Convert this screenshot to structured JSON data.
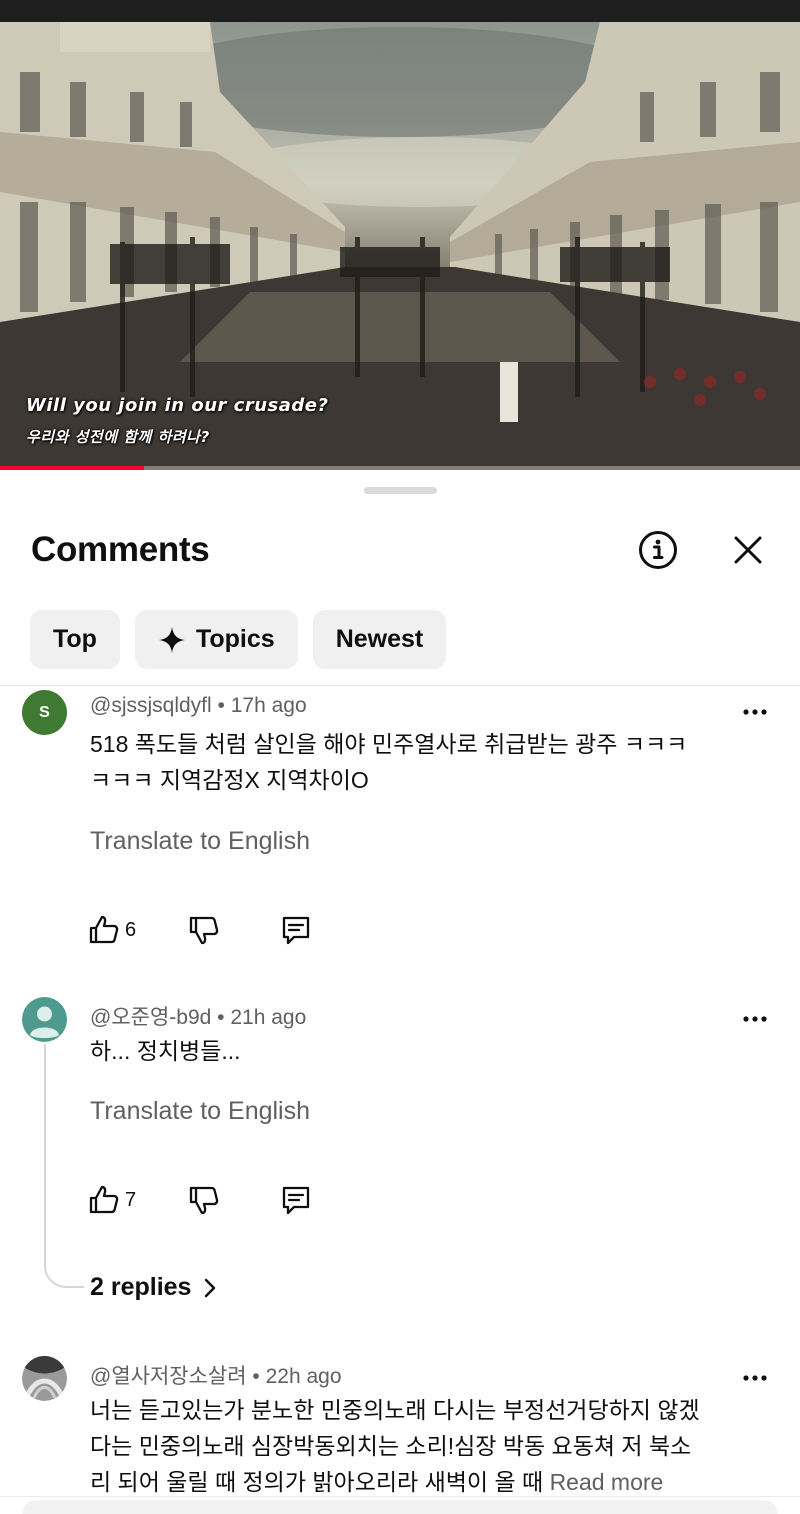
{
  "video": {
    "subtitle_en": "Will you join in our crusade?",
    "subtitle_ko": "우리와 성전에 함께 하려나?",
    "progress": 0.18
  },
  "sheet": {
    "title": "Comments",
    "info_icon": "info-circle-icon",
    "close_icon": "close-icon"
  },
  "filters": [
    {
      "label": "Top"
    },
    {
      "label": "Topics",
      "icon": "sparkle-icon"
    },
    {
      "label": "Newest"
    }
  ],
  "comments": [
    {
      "author": "@sjssjsqldyfl",
      "time": "17h ago",
      "avatar_letter": "S",
      "avatar_color": "#3e7a32",
      "line1": "518 폭도들 처럼 살인을 해야 민주열사로 취급받는 광주 ㅋㅋㅋ",
      "line2": "ㅋㅋㅋ 지역감정X 지역차이O",
      "translate": "Translate to English",
      "likes": "6"
    },
    {
      "author": "@오준영-b9d",
      "time": "21h ago",
      "avatar_color": "#4f9a8e",
      "line1": "하... 정치병들...",
      "translate": "Translate to English",
      "likes": "7",
      "replies": "2 replies"
    },
    {
      "author": "@열사저장소살려",
      "time": "22h ago",
      "line1": "너는 듣고있는가 분노한 민중의노래 다시는 부정선거당하지 않겠",
      "line2": "다는 민중의노래 심장박동외치는 소리!심장 박동 요동쳐 저 북소",
      "line3": "리 되어 울릴 때 정의가 밝아오리라 새벽이 올 때",
      "read_more": "Read more"
    }
  ],
  "separator": " • "
}
